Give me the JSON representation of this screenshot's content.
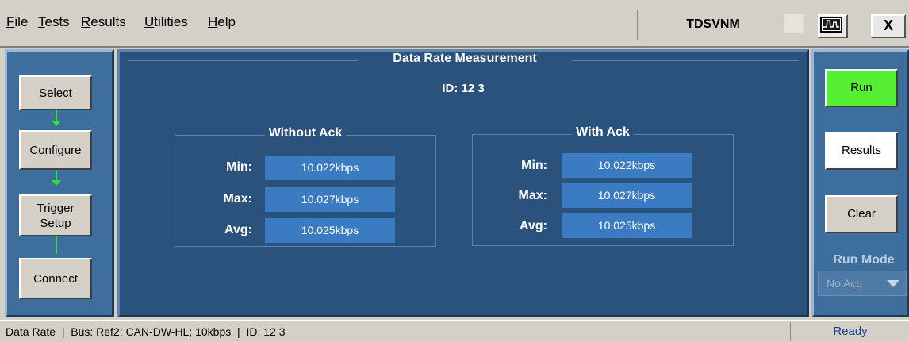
{
  "menu": [
    "File",
    "Tests",
    "Results",
    "Utilities",
    "Help"
  ],
  "app_title": "TDSVNM",
  "close_label": "X",
  "nav": {
    "select": "Select",
    "configure": "Configure",
    "trigger_line1": "Trigger",
    "trigger_line2": "Setup",
    "connect": "Connect"
  },
  "controls": {
    "run": "Run",
    "results": "Results",
    "clear": "Clear",
    "run_mode_label": "Run Mode",
    "run_mode_value": "No Acq"
  },
  "main": {
    "title": "Data Rate Measurement",
    "id": "ID: 12 3",
    "groups": [
      {
        "title": "Without Ack",
        "rows": [
          {
            "label": "Min:",
            "value": "10.022kbps"
          },
          {
            "label": "Max:",
            "value": "10.027kbps"
          },
          {
            "label": "Avg:",
            "value": "10.025kbps"
          }
        ]
      },
      {
        "title": "With Ack",
        "rows": [
          {
            "label": "Min:",
            "value": "10.022kbps"
          },
          {
            "label": "Max:",
            "value": "10.027kbps"
          },
          {
            "label": "Avg:",
            "value": "10.025kbps"
          }
        ]
      }
    ]
  },
  "status": {
    "text": "Data Rate  |  Bus: Ref2; CAN-DW-HL; 10kbps  |  ID: 12 3",
    "state": "Ready"
  },
  "colors": {
    "run_button": "#55ee33",
    "panel_blue": "#2a527c",
    "value_box": "#3b7bc1",
    "flow_arrow": "#2ee82e"
  },
  "icons": [
    "oscilloscope-icon",
    "close-icon",
    "dropdown-arrow-icon"
  ]
}
